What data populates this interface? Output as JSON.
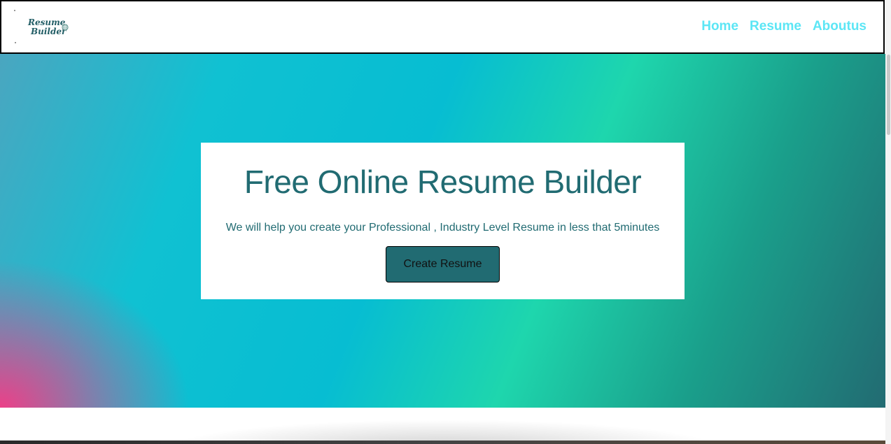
{
  "navbar": {
    "logo": {
      "line1": "Resume",
      "line2": "Builder",
      "icon": "globe-icon"
    },
    "links": [
      {
        "label": "Home"
      },
      {
        "label": "Resume"
      },
      {
        "label": "Aboutus"
      }
    ],
    "link_color": "#5ce6f5"
  },
  "hero": {
    "title": "Free Online Resume Builder",
    "subtitle": "We will help you create your Professional , Industry Level Resume in less that 5minutes",
    "cta_label": "Create Resume",
    "text_color": "#216b72",
    "gradient_colors": [
      "#ec4088",
      "#07bdd2",
      "#1ed6ad",
      "#226b72"
    ]
  }
}
